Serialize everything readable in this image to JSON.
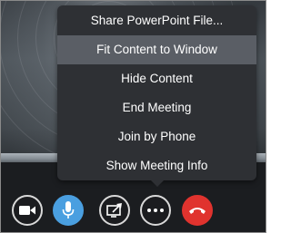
{
  "menu": {
    "items": [
      {
        "label": "Share PowerPoint File..."
      },
      {
        "label": "Fit Content to Window",
        "highlighted": true
      },
      {
        "label": "Hide Content"
      },
      {
        "label": "End Meeting"
      },
      {
        "label": "Join by Phone"
      },
      {
        "label": "Show Meeting Info"
      }
    ]
  },
  "toolbar": {
    "buttons": [
      {
        "icon": "video-camera-icon",
        "color": "#1b1c1f"
      },
      {
        "icon": "microphone-icon",
        "color": "#4a9fe0"
      },
      {
        "icon": "share-screen-icon",
        "color": "#1b1c1f"
      },
      {
        "icon": "more-options-icon",
        "color": "#1b1c1f"
      },
      {
        "icon": "hang-up-phone-icon",
        "color": "#e0332e"
      }
    ]
  }
}
